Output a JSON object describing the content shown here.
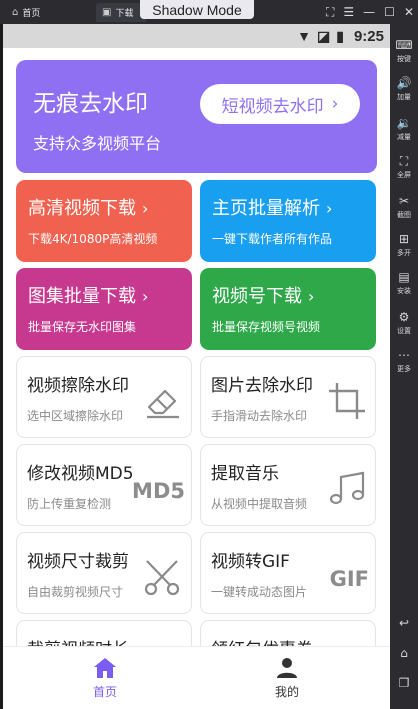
{
  "emulator": {
    "tabs": [
      {
        "label": "首页"
      },
      {
        "label": "下载"
      }
    ],
    "mode_label": "Shadow Mode",
    "side_buttons": [
      {
        "label": "按键",
        "icon": "keyboard-icon"
      },
      {
        "label": "加量",
        "icon": "volume-up-icon"
      },
      {
        "label": "减量",
        "icon": "volume-down-icon"
      },
      {
        "label": "全屏",
        "icon": "fullscreen-icon"
      },
      {
        "label": "截图",
        "icon": "scissors-icon"
      },
      {
        "label": "多开",
        "icon": "multi-instance-icon"
      },
      {
        "label": "安装",
        "icon": "apk-icon"
      },
      {
        "label": "设置",
        "icon": "gear-icon"
      },
      {
        "label": "更多",
        "icon": "more-icon"
      }
    ]
  },
  "status": {
    "time": "9:25"
  },
  "hero": {
    "title": "无痕去水印",
    "subtitle": "支持众多视频平台",
    "button": "短视频去水印",
    "color": "#8f6ff2"
  },
  "feature_cards": [
    {
      "title": "高清视频下载",
      "subtitle": "下载4K/1080P高清视频",
      "color": "#f0614f"
    },
    {
      "title": "主页批量解析",
      "subtitle": "一键下载作者所有作品",
      "color": "#199ff0"
    },
    {
      "title": "图集批量下载",
      "subtitle": "批量保存无水印图集",
      "color": "#c7398e"
    },
    {
      "title": "视频号下载",
      "subtitle": "批量保存视频号视频",
      "color": "#2ea849"
    }
  ],
  "tools": [
    {
      "title": "视频擦除水印",
      "subtitle": "选中区域擦除水印",
      "icon": "eraser-icon"
    },
    {
      "title": "图片去除水印",
      "subtitle": "手指滑动去除水印",
      "icon": "crop-icon"
    },
    {
      "title": "修改视频MD5",
      "subtitle": "防上传重复检测",
      "icon": "md5-icon",
      "icon_text": "MD5"
    },
    {
      "title": "提取音乐",
      "subtitle": "从视频中提取音频",
      "icon": "music-note-icon"
    },
    {
      "title": "视频尺寸裁剪",
      "subtitle": "自由裁剪视频尺寸",
      "icon": "scissors-icon"
    },
    {
      "title": "视频转GIF",
      "subtitle": "一键转成动态图片",
      "icon": "gif-icon",
      "icon_text": "GIF"
    },
    {
      "title": "裁剪视频时长",
      "subtitle": "",
      "icon": "timer-icon"
    },
    {
      "title": "领红包优惠券",
      "subtitle": "",
      "icon": "red-envelope-icon"
    }
  ],
  "bottom_nav": [
    {
      "label": "首页",
      "icon": "home-icon",
      "active": true
    },
    {
      "label": "我的",
      "icon": "user-icon",
      "active": false
    }
  ],
  "accent_color": "#7a5cf0"
}
